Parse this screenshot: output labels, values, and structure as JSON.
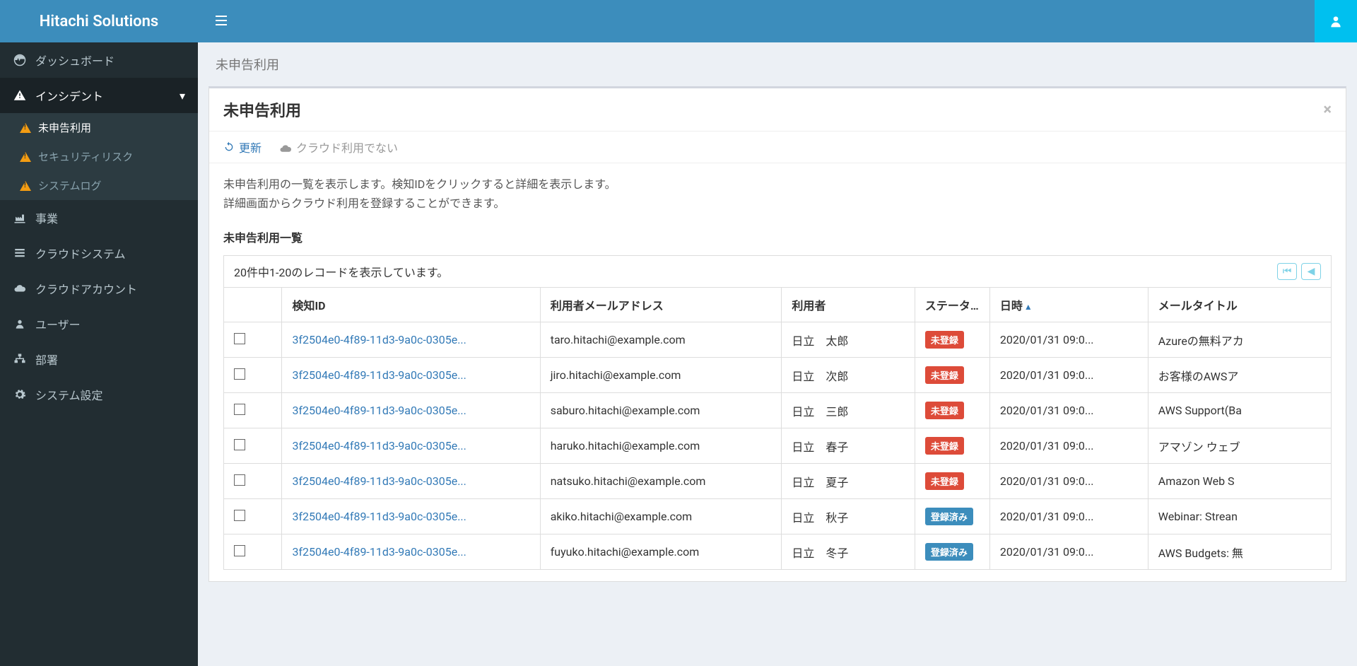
{
  "brand": "Hitachi Solutions",
  "sidebar": {
    "items": [
      {
        "label": "ダッシュボード",
        "icon": "dashboard"
      },
      {
        "label": "インシデント",
        "icon": "warn",
        "expanded": true
      },
      {
        "label": "事業",
        "icon": "factory"
      },
      {
        "label": "クラウドシステム",
        "icon": "list"
      },
      {
        "label": "クラウドアカウント",
        "icon": "cloud"
      },
      {
        "label": "ユーザー",
        "icon": "user"
      },
      {
        "label": "部署",
        "icon": "org"
      },
      {
        "label": "システム設定",
        "icon": "gear"
      }
    ],
    "incident_sub": [
      {
        "label": "未申告利用",
        "active": true
      },
      {
        "label": "セキュリティリスク",
        "active": false
      },
      {
        "label": "システムログ",
        "active": false
      }
    ]
  },
  "breadcrumb": "未申告利用",
  "panel": {
    "title": "未申告利用",
    "refresh": "更新",
    "not_cloud": "クラウド利用でない",
    "desc_line1": "未申告利用の一覧を表示します。検知IDをクリックすると詳細を表示します。",
    "desc_line2": "詳細画面からクラウド利用を登録することができます。",
    "list_title": "未申告利用一覧",
    "record_count": "20件中1-20のレコードを表示しています。"
  },
  "status_labels": {
    "unregistered": "未登録",
    "registered": "登録済み"
  },
  "table": {
    "headers": {
      "id": "検知ID",
      "email": "利用者メールアドレス",
      "user": "利用者",
      "status": "ステータス",
      "date": "日時",
      "title": "メールタイトル"
    },
    "rows": [
      {
        "id": "3f2504e0-4f89-11d3-9a0c-0305e...",
        "email": "taro.hitachi@example.com",
        "user": "日立　太郎",
        "status": "unregistered",
        "date": "2020/01/31 09:0...",
        "title": "Azureの無料アカ"
      },
      {
        "id": "3f2504e0-4f89-11d3-9a0c-0305e...",
        "email": "jiro.hitachi@example.com",
        "user": "日立　次郎",
        "status": "unregistered",
        "date": "2020/01/31 09:0...",
        "title": "お客様のAWSア"
      },
      {
        "id": "3f2504e0-4f89-11d3-9a0c-0305e...",
        "email": "saburo.hitachi@example.com",
        "user": "日立　三郎",
        "status": "unregistered",
        "date": "2020/01/31 09:0...",
        "title": "AWS Support(Ba"
      },
      {
        "id": "3f2504e0-4f89-11d3-9a0c-0305e...",
        "email": "haruko.hitachi@example.com",
        "user": "日立　春子",
        "status": "unregistered",
        "date": "2020/01/31 09:0...",
        "title": "アマゾン ウェブ"
      },
      {
        "id": "3f2504e0-4f89-11d3-9a0c-0305e...",
        "email": "natsuko.hitachi@example.com",
        "user": "日立　夏子",
        "status": "unregistered",
        "date": "2020/01/31 09:0...",
        "title": "Amazon Web S"
      },
      {
        "id": "3f2504e0-4f89-11d3-9a0c-0305e...",
        "email": "akiko.hitachi@example.com",
        "user": "日立　秋子",
        "status": "registered",
        "date": "2020/01/31 09:0...",
        "title": "Webinar: Strean"
      },
      {
        "id": "3f2504e0-4f89-11d3-9a0c-0305e...",
        "email": "fuyuko.hitachi@example.com",
        "user": "日立　冬子",
        "status": "registered",
        "date": "2020/01/31 09:0...",
        "title": "AWS Budgets: 無"
      }
    ]
  }
}
